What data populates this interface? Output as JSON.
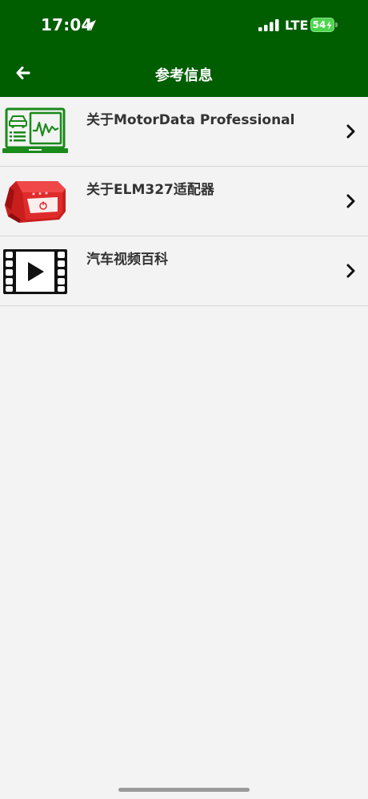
{
  "status_bar": {
    "time": "17:04",
    "network": "LTE",
    "battery_level": "54",
    "icons": [
      "location-arrow-icon",
      "signal-bars-icon",
      "battery-charging-icon"
    ]
  },
  "nav": {
    "title": "参考信息",
    "back_icon": "arrow-left-icon"
  },
  "items": [
    {
      "label": "关于MotorData Professional",
      "icon": "laptop-diagnostics-icon"
    },
    {
      "label": "关于ELM327适配器",
      "icon": "obd-adapter-icon"
    },
    {
      "label": "汽车视频百科",
      "icon": "video-film-icon"
    }
  ],
  "colors": {
    "header": "#005d00",
    "background": "#f3f3f3",
    "text": "#333333",
    "divider": "#d6d6d6",
    "battery": "#4bd64b",
    "icon_green": "#1a8a1a",
    "adapter_red": "#e02b2b"
  }
}
